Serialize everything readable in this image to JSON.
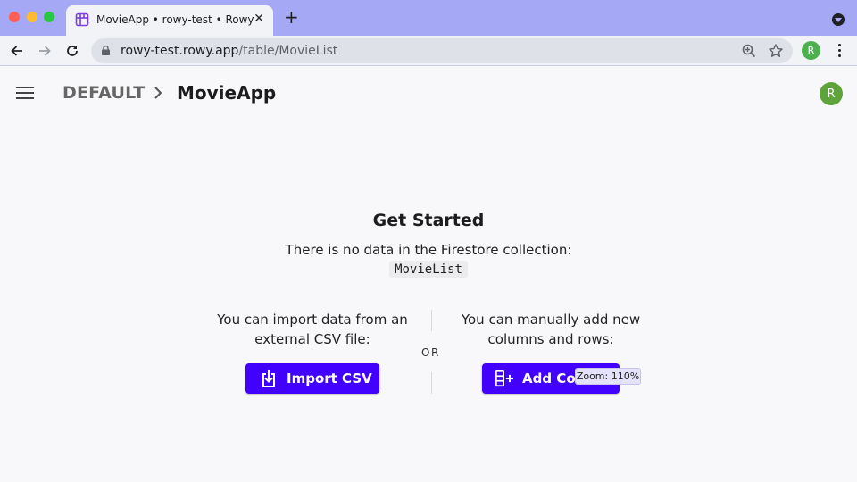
{
  "browser": {
    "tab_title": "MovieApp • rowy-test • Rowy",
    "tab_close": "✕",
    "new_tab": "+",
    "url_host": "rowy-test.rowy.app",
    "url_path": "/table/MovieList",
    "profile_initial": "R"
  },
  "header": {
    "section": "DEFAULT",
    "table_name": "MovieApp",
    "avatar_initial": "R"
  },
  "empty_state": {
    "title": "Get Started",
    "description": "There is no data in the Firestore collection:",
    "collection": "MovieList",
    "import_text": "You can import data from an external CSV file:",
    "or_label": "OR",
    "manual_text": "You can manually add new columns and rows:",
    "import_button": "Import CSV",
    "add_button": "Add Columns"
  },
  "zoom_tooltip": "Zoom: 110%",
  "colors": {
    "primary": "#4200ff",
    "tabbar": "#a5a9f5",
    "avatar": "#5ea43b"
  }
}
